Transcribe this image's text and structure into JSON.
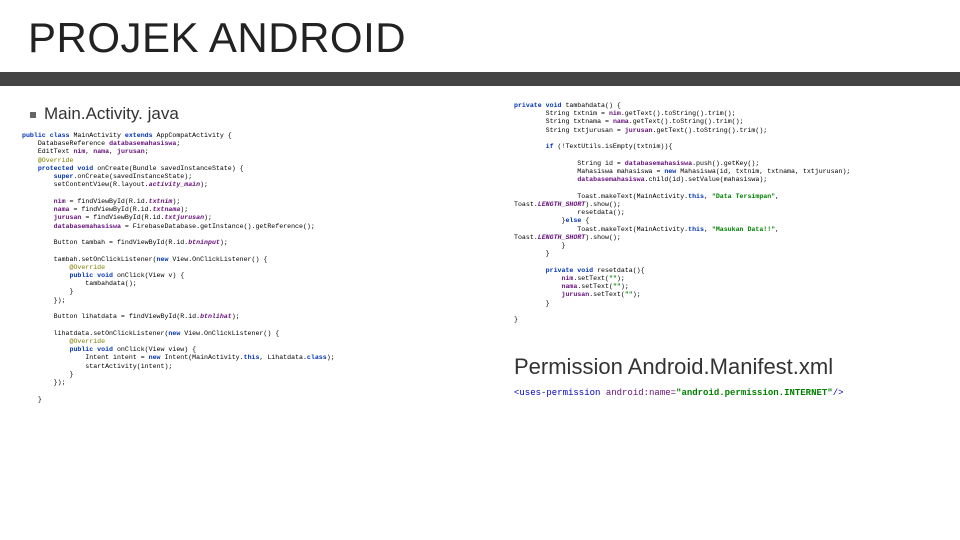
{
  "title": "PROJEK ANDROID",
  "left": {
    "bullet": "Main.Activity. java",
    "code": "<span class='kw'>public class</span> MainActivity <span class='kw'>extends</span> AppCompatActivity {\n    DatabaseReference <span class='var'>databasemahasiswa</span>;\n    EditText <span class='var'>nim</span>, <span class='var'>nama</span>, <span class='var'>jurusan</span>;\n    <span class='ann'>@Override</span>\n    <span class='kw'>protected void</span> onCreate(Bundle savedInstanceState) {\n        <span class='kw'>super</span>.onCreate(savedInstanceState);\n        setContentView(R.layout.<span class='id'>activity_main</span>);\n\n        <span class='var'>nim</span> = findViewById(R.id.<span class='id'>txtnim</span>);\n        <span class='var'>nama</span> = findViewById(R.id.<span class='id'>txtnama</span>);\n        <span class='var'>jurusan</span> = findViewById(R.id.<span class='id'>txtjurusan</span>);\n        <span class='var'>databasemahasiswa</span> = FirebaseDatabase.getInstance().getReference();\n\n        Button tambah = findViewById(R.id.<span class='id'>btninput</span>);\n\n        tambah.setOnClickListener(<span class='kw'>new</span> View.OnClickListener() {\n            <span class='ann'>@Override</span>\n            <span class='kw'>public void</span> onClick(View v) {\n                tambahdata();\n            }\n        });\n\n        Button lihatdata = findViewById(R.id.<span class='id'>btnlihat</span>);\n\n        lihatdata.setOnClickListener(<span class='kw'>new</span> View.OnClickListener() {\n            <span class='ann'>@Override</span>\n            <span class='kw'>public void</span> onClick(View view) {\n                Intent intent = <span class='kw'>new</span> Intent(MainActivity.<span class='kw'>this</span>, Lihatdata.<span class='kw'>class</span>);\n                startActivity(intent);\n            }\n        });\n\n    }"
  },
  "right": {
    "code": "<span class='kw'>private void</span> tambahdata() {\n        String txtnim = <span class='var'>nim</span>.getText().toString().trim();\n        String txtnama = <span class='var'>nama</span>.getText().toString().trim();\n        String txtjurusan = <span class='var'>jurusan</span>.getText().toString().trim();\n\n        <span class='kw'>if</span> (!TextUtils.isEmpty(txtnim)){\n\n                String id = <span class='var'>databasemahasiswa</span>.push().getKey();\n                Mahasiswa mahasiswa = <span class='kw'>new</span> Mahasiswa(id, txtnim, txtnama, txtjurusan);\n                <span class='var'>databasemahasiswa</span>.child(id).setValue(mahasiswa);\n\n                Toast.makeText(MainActivity.<span class='kw'>this</span>, <span class='str'>\"Data Tersimpan\"</span>,\nToast.<span class='id'>LENGTH_SHORT</span>).show();\n                resetdata();\n            }<span class='kw'>else</span> {\n                Toast.makeText(MainActivity.<span class='kw'>this</span>, <span class='str'>\"Masukan Data!!\"</span>,\nToast.<span class='id'>LENGTH_SHORT</span>).show();\n            }\n        }\n\n        <span class='kw'>private void</span> resetdata(){\n            <span class='var'>nim</span>.setText(<span class='str'>\"\"</span>);\n            <span class='var'>nama</span>.setText(<span class='str'>\"\"</span>);\n            <span class='var'>jurusan</span>.setText(<span class='str'>\"\"</span>);\n        }\n\n}",
    "perm_title": "Permission Android.Manifest.xml",
    "perm_code": "<span class='tag'>&lt;uses-permission</span> <span class='attr'>android:name=</span><span class='aval'>\"android.permission.INTERNET\"</span><span class='tag'>/&gt;</span>"
  }
}
